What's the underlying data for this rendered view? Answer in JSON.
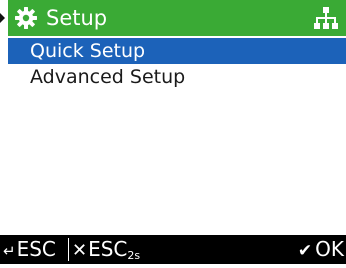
{
  "colors": {
    "header_bg": "#3aaa35",
    "selection_bg": "#1c62b9",
    "footer_bg": "#000000",
    "text": "#1a1a1a"
  },
  "header": {
    "title": "Setup",
    "left_icon": "gear-icon",
    "right_icon": "network-icon"
  },
  "menu": {
    "items": [
      {
        "label": "Quick Setup",
        "selected": true
      },
      {
        "label": "Advanced Setup",
        "selected": false
      }
    ]
  },
  "footer": {
    "back_icon": "back-arrow-icon",
    "back_label": "ESC",
    "cancel_icon": "x-icon",
    "cancel_label": "ESC",
    "cancel_sub": "2s",
    "ok_icon": "check-icon",
    "ok_label": "OK"
  }
}
